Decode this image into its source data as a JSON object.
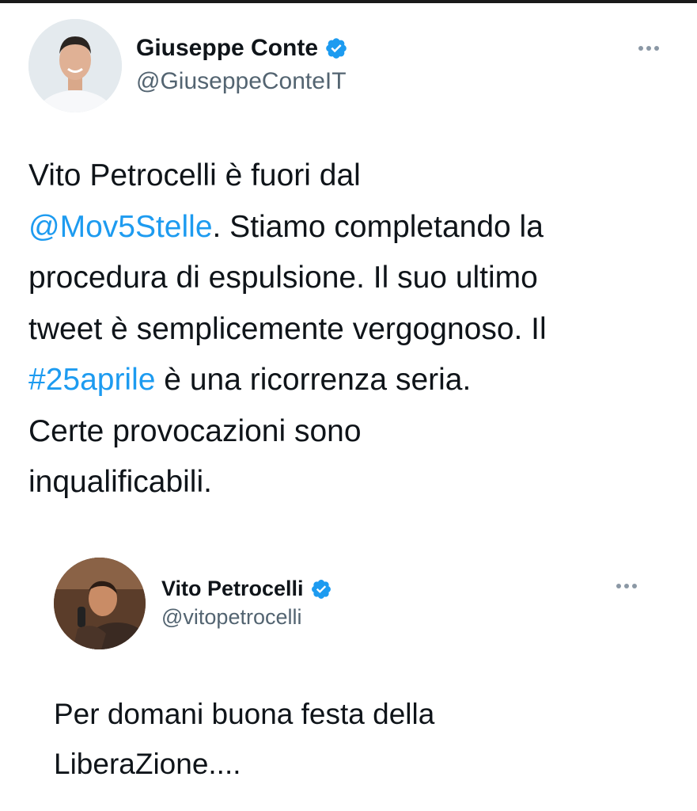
{
  "tweet": {
    "author": {
      "name": "Giuseppe Conte",
      "handle": "@GiuseppeConteIT",
      "verified": true
    },
    "text": {
      "line1": "Vito Petrocelli è fuori dal",
      "mention": "@Mov5Stelle",
      "line2_rest": ". Stiamo completando la",
      "line3": "procedura di espulsione. Il suo ultimo",
      "line4": "tweet è semplicemente vergognoso. Il",
      "hashtag": "#25aprile",
      "line5_rest": " è una ricorrenza seria.",
      "line6": "Certe provocazioni sono",
      "line7": "inqualificabili."
    }
  },
  "quoted_tweet": {
    "author": {
      "name": "Vito Petrocelli",
      "handle": "@vitopetrocelli",
      "verified": true
    },
    "text": {
      "line1": "Per domani buona festa della",
      "line2": "LiberaZione...."
    }
  },
  "icons": {
    "verified": "verified-badge-icon",
    "more": "more-options-icon"
  },
  "colors": {
    "link": "#1d9bf0",
    "verified": "#1d9bf0",
    "handle": "#536471",
    "text": "#0f1419"
  }
}
